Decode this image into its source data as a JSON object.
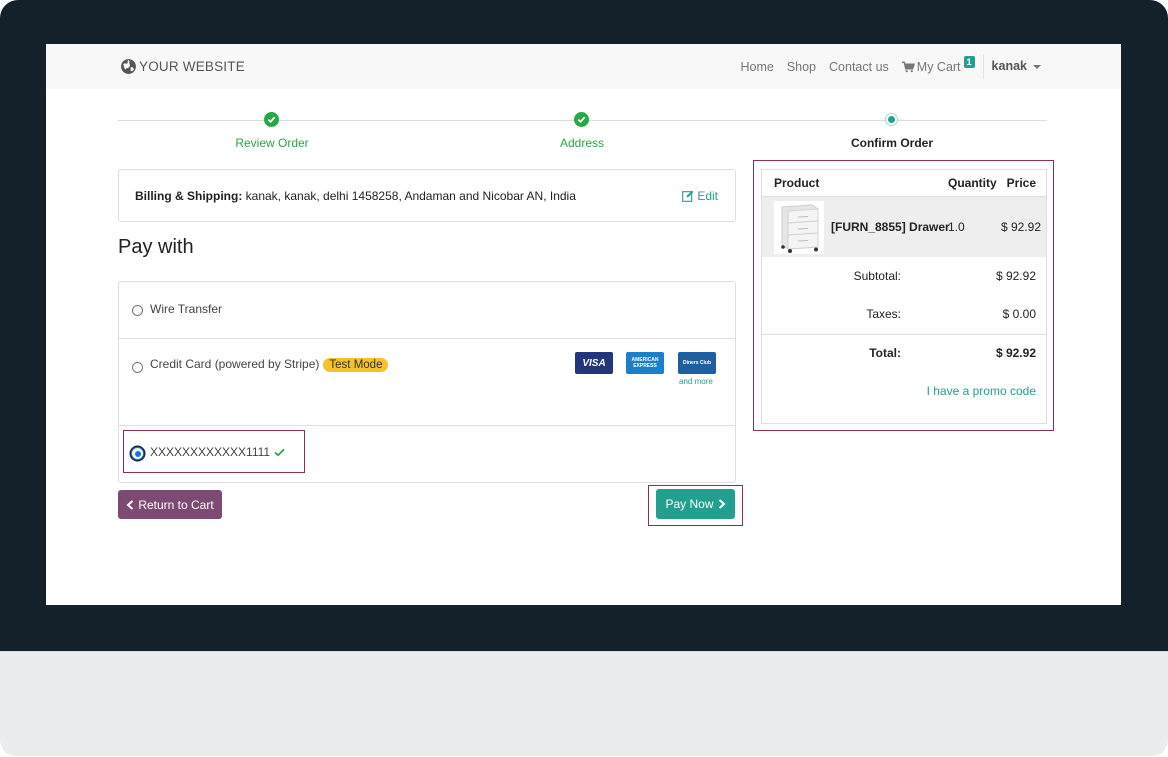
{
  "navbar": {
    "brand": "YOUR WEBSITE",
    "links": [
      "Home",
      "Shop",
      "Contact us"
    ],
    "cart_label": "My Cart",
    "cart_count": "1",
    "user": "kanak"
  },
  "steps": [
    {
      "label": "Review Order",
      "state": "done"
    },
    {
      "label": "Address",
      "state": "done"
    },
    {
      "label": "Confirm Order",
      "state": "current"
    }
  ],
  "billing": {
    "label": "Billing & Shipping:",
    "address": " kanak, kanak, delhi 1458258, Andaman and Nicobar AN, India",
    "edit_label": "Edit"
  },
  "pay_with_title": "Pay with",
  "payment_methods": {
    "wire_transfer": "Wire Transfer",
    "credit_card": "Credit Card (powered by Stripe)",
    "test_mode_badge": "Test Mode",
    "card_logos": [
      "VISA",
      "AMERICAN EXPRESS",
      "Diners Club"
    ],
    "and_more": "and more",
    "saved_token": "XXXXXXXXXXXX1111"
  },
  "buttons": {
    "return_to_cart": "Return to Cart",
    "pay_now": "Pay Now"
  },
  "summary": {
    "headers": {
      "product": "Product",
      "quantity": "Quantity",
      "price": "Price"
    },
    "item": {
      "name": "[FURN_8855] Drawer",
      "quantity": "1.0",
      "price": "$ 92.92"
    },
    "subtotal_label": "Subtotal:",
    "subtotal_value": "$ 92.92",
    "taxes_label": "Taxes:",
    "taxes_value": "$ 0.00",
    "total_label": "Total:",
    "total_value": "$ 92.92",
    "promo": "I have a promo code"
  },
  "colors": {
    "accent": "#21a08f",
    "success": "#28a745",
    "secondary_button": "#7c4a73",
    "highlight_border": "#8b2e5d",
    "badge": "#f4c32b"
  }
}
